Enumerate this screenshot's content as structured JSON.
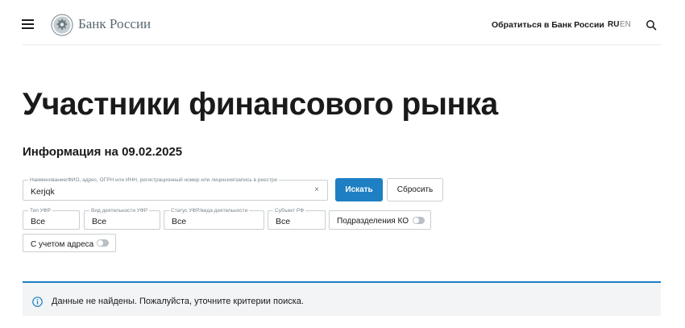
{
  "header": {
    "brand": "Банк России",
    "contact_link": "Обратиться в Банк России",
    "lang_ru": "RU",
    "lang_en": "EN",
    "icons": [
      "menu-icon",
      "bank-emblem-logo",
      "search-icon"
    ]
  },
  "page": {
    "title": "Участники финансового рынка",
    "info_date": "Информация на 09.02.2025"
  },
  "form": {
    "main_field": {
      "label": "Наименование/ФИО, адрес, ОГРН или ИНН, регистрационный номер или лицензия/запись в реестре",
      "value": "Kerjqk",
      "clear_glyph": "×"
    },
    "search_button": "Искать",
    "reset_button": "Сбросить",
    "filters": [
      {
        "label": "Тип УФР",
        "value": "Все"
      },
      {
        "label": "Вид деятельности УФР",
        "value": "Все"
      },
      {
        "label": "Статус УФР/вида деятельности",
        "value": "Все"
      },
      {
        "label": "Субъект РФ",
        "value": "Все"
      }
    ],
    "toggle_divisions": {
      "label": "Подразделения КО",
      "on": false
    },
    "toggle_address": {
      "label": "С учетом адреса",
      "on": false
    }
  },
  "notice": {
    "text": "Данные не найдены. Пожалуйста, уточните критерии поиска.",
    "icon": "info-icon"
  },
  "colors": {
    "accent": "#1e7fc3",
    "notice_bg": "#f2f4f5",
    "border": "#c9cfd3"
  }
}
